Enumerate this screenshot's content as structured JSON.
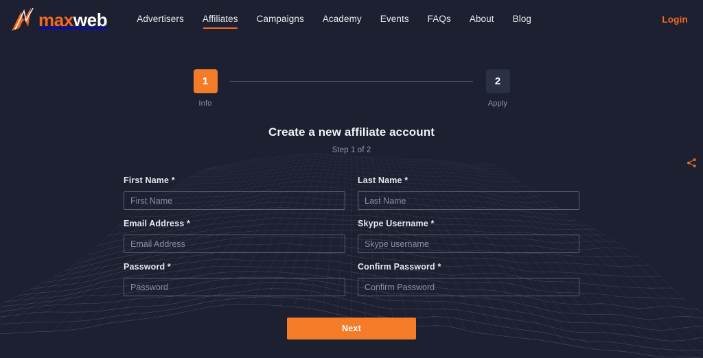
{
  "brand": {
    "name_part_1": "max",
    "name_part_2": "web",
    "mark_icon": "lightning-chart-icon",
    "accent_color": "#f26a21"
  },
  "header": {
    "nav_items": [
      {
        "label": "Advertisers",
        "active": false
      },
      {
        "label": "Affiliates",
        "active": true
      },
      {
        "label": "Campaigns",
        "active": false
      },
      {
        "label": "Academy",
        "active": false
      },
      {
        "label": "Events",
        "active": false
      },
      {
        "label": "FAQs",
        "active": false
      },
      {
        "label": "About",
        "active": false
      },
      {
        "label": "Blog",
        "active": false
      }
    ],
    "login_label": "Login"
  },
  "share_rail": {
    "icon": "share-icon",
    "color": "#f26a21"
  },
  "stepper": {
    "steps": [
      {
        "number": "1",
        "label": "Info",
        "state": "active",
        "color": "#f47b28"
      },
      {
        "number": "2",
        "label": "Apply",
        "state": "inactive",
        "color": "#2b3043"
      }
    ]
  },
  "form": {
    "title": "Create a new affiliate account",
    "subtitle": "Step 1 of 2",
    "fields": [
      {
        "label": "First Name *",
        "placeholder": "First Name",
        "value": "",
        "type": "text",
        "name": "first-name"
      },
      {
        "label": "Last Name *",
        "placeholder": "Last Name",
        "value": "",
        "type": "text",
        "name": "last-name"
      },
      {
        "label": "Email Address *",
        "placeholder": "Email Address",
        "value": "",
        "type": "text",
        "name": "email-address"
      },
      {
        "label": "Skype Username *",
        "placeholder": "Skype username",
        "value": "",
        "type": "text",
        "name": "skype-username"
      },
      {
        "label": "Password *",
        "placeholder": "Password",
        "value": "",
        "type": "password",
        "name": "password"
      },
      {
        "label": "Confirm Password *",
        "placeholder": "Confirm Password",
        "value": "",
        "type": "password",
        "name": "confirm-password"
      }
    ],
    "submit_label": "Next"
  },
  "theme": {
    "background": "#1d2030",
    "accent": "#f47b28",
    "text": "#e8eaf0",
    "muted_text": "#9196a8",
    "input_border": "#5b6075"
  }
}
